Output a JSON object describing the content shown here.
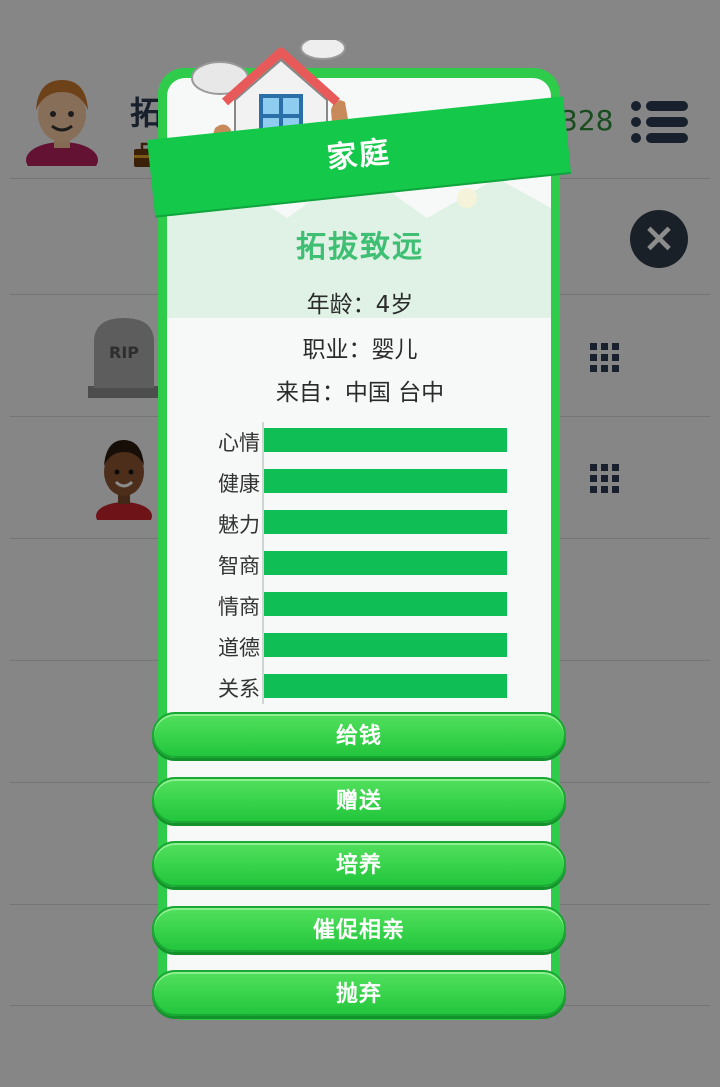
{
  "background": {
    "player_name": "拓",
    "money": "328",
    "tombstone_text": "RIP"
  },
  "popup": {
    "title": "家庭",
    "person_name": "拓拔致远",
    "age": "年龄：4岁",
    "job": "职业：婴儿",
    "origin": "来自：中国 台中",
    "stats": [
      {
        "label": "心情",
        "value": 100
      },
      {
        "label": "健康",
        "value": 100
      },
      {
        "label": "魅力",
        "value": 100
      },
      {
        "label": "智商",
        "value": 100
      },
      {
        "label": "情商",
        "value": 100
      },
      {
        "label": "道德",
        "value": 100
      },
      {
        "label": "关系",
        "value": 100
      }
    ],
    "stat_max": 100,
    "actions": [
      "给钱",
      "赠送",
      "培养",
      "催促相亲",
      "抛弃"
    ]
  },
  "colors": {
    "accent_green": "#14c84a",
    "bar_green": "#0fbe54",
    "name_green": "#3fbf74"
  }
}
